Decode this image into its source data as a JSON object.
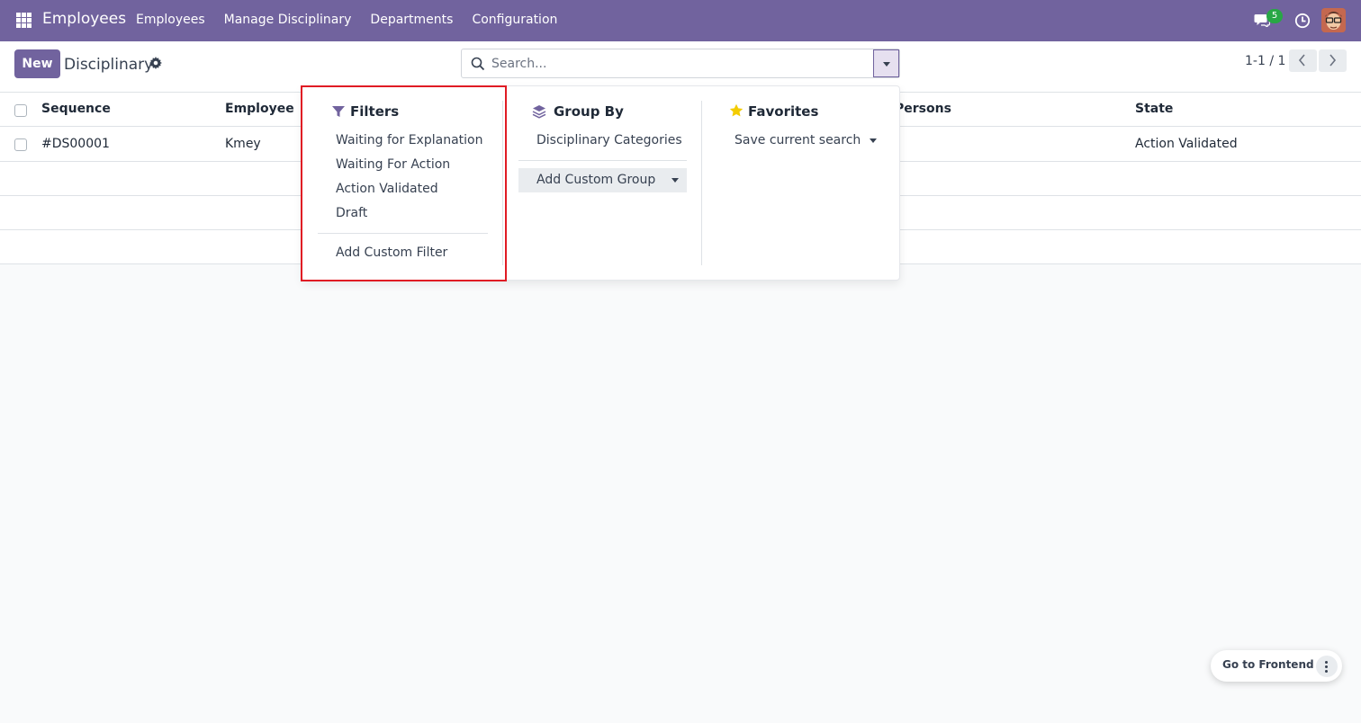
{
  "navbar": {
    "brand": "Employees",
    "menu": [
      "Employees",
      "Manage Disciplinary",
      "Departments",
      "Configuration"
    ],
    "chat_badge": "5",
    "color": "#71639e"
  },
  "control": {
    "new_label": "New",
    "title": "Disciplinary",
    "search_placeholder": "Search...",
    "pager": "1-1 / 1"
  },
  "table": {
    "columns": [
      "Sequence",
      "Employee",
      "Persons",
      "State"
    ],
    "rows": [
      {
        "sequence": "#DS00001",
        "employee": "Kmey",
        "persons": "",
        "state": "Action Validated"
      }
    ]
  },
  "dropdown": {
    "filters": {
      "title": "Filters",
      "items": [
        "Waiting for Explanation",
        "Waiting For Action",
        "Action Validated",
        "Draft"
      ],
      "custom": "Add Custom Filter"
    },
    "group_by": {
      "title": "Group By",
      "items": [
        "Disciplinary Categories"
      ],
      "custom": "Add Custom Group"
    },
    "favorites": {
      "title": "Favorites",
      "save": "Save current search"
    }
  },
  "floating": {
    "frontend_label": "Go to Frontend"
  },
  "colors": {
    "accent": "#71639e",
    "highlight": "#e01b24",
    "badge": "#28a745",
    "star": "#f3cc00"
  }
}
